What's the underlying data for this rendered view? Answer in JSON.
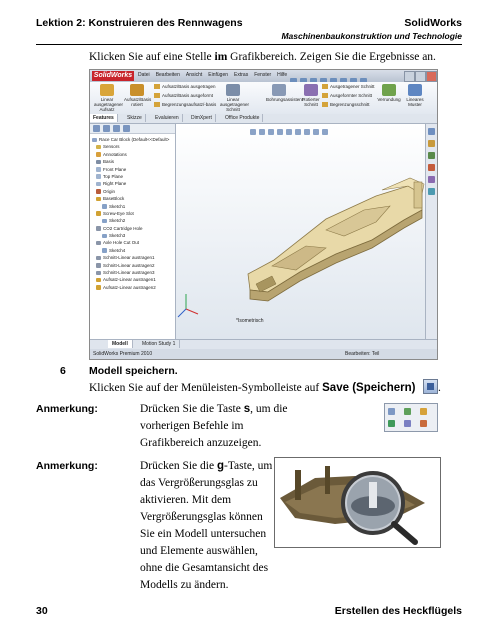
{
  "header": {
    "lesson": "Lektion 2: Konstruieren des Rennwagens",
    "product": "SolidWorks",
    "subtitle": "Maschinenbaukonstruktion und Technologie"
  },
  "intro": {
    "before": "Klicken Sie auf eine Stelle ",
    "bold": "im",
    "after": " Grafikbereich. Zeigen Sie die Ergebnisse an."
  },
  "screenshot": {
    "logo": "SolidWorks",
    "menu": [
      "Datei",
      "Bearbeiten",
      "Ansicht",
      "Einfügen",
      "Extras",
      "Fenster",
      "Hilfe"
    ],
    "ribbon": {
      "big_buttons": [
        {
          "label": "Linear ausgetragener Aufsatz",
          "color": "#d9a53a"
        },
        {
          "label": "Aufsatz/Basis rotiert",
          "color": "#c98f2a"
        },
        {
          "label": "Linear ausgetragener Schnitt",
          "color": "#7b8da8"
        },
        {
          "label": "Bohrungsassistent",
          "color": "#8899b5"
        },
        {
          "label": "Rotierter Schnitt",
          "color": "#8a6fb1"
        },
        {
          "label": "Verrundung",
          "color": "#6fa24c"
        },
        {
          "label": "Lineares Muster",
          "color": "#5e86c2"
        }
      ],
      "small_buttons": [
        "Aufsatz/Basis ausgetragen",
        "Aufsatz/Basis ausgeformt",
        "Begrenzungsaufsatz/-basis",
        "Ausgetragener Schnitt",
        "Ausgeformter Schnitt",
        "Begrenzungsschnitt"
      ]
    },
    "command_tabs": [
      "Features",
      "Skizze",
      "Evaluieren",
      "DimXpert",
      "Office Produkte"
    ],
    "tree": [
      {
        "label": "Race Car Block (Default<<Default>",
        "color": "#8ca3c9"
      },
      {
        "label": "Sensors",
        "color": "#d2b24a"
      },
      {
        "label": "Annotations",
        "color": "#d9a03b"
      },
      {
        "label": "Basis",
        "color": "#7e8da3"
      },
      {
        "label": "Front Plane",
        "color": "#9fb3cf"
      },
      {
        "label": "Top Plane",
        "color": "#9fb3cf"
      },
      {
        "label": "Right Plane",
        "color": "#9fb3cf"
      },
      {
        "label": "Origin",
        "color": "#b85c3c"
      },
      {
        "label": "BaseBlock",
        "color": "#d1a233"
      },
      {
        "label": "Sketch1",
        "color": "#86a1c7"
      },
      {
        "label": "Screw-Eye Slot",
        "color": "#d1a233"
      },
      {
        "label": "Sketch2",
        "color": "#86a1c7"
      },
      {
        "label": "CO2 Cartridge Hole",
        "color": "#8a95a8"
      },
      {
        "label": "Sketch3",
        "color": "#86a1c7"
      },
      {
        "label": "Axle Hole Cut Out",
        "color": "#8a95a8"
      },
      {
        "label": "Sketch4",
        "color": "#86a1c7"
      },
      {
        "label": "Schnitt-Linear austragen1",
        "color": "#8a95a8"
      },
      {
        "label": "Schnitt-Linear austragen2",
        "color": "#8a95a8"
      },
      {
        "label": "Schnitt-Linear austragen3",
        "color": "#8a95a8"
      },
      {
        "label": "Aufsatz-Linear austragen1",
        "color": "#d1a233"
      },
      {
        "label": "Aufsatz-Linear austragen2",
        "color": "#d1a233"
      }
    ],
    "view_label": "*Isometrisch",
    "bottom_tabs": [
      "Modell",
      "Motion Study 1"
    ],
    "status_left": "SolidWorks Premium 2010",
    "status_right": "Bearbeiten: Teil"
  },
  "step6": {
    "number": "6",
    "title": "Modell speichern.",
    "text_before": "Klicken Sie auf der Menüleisten-Symbolleiste auf ",
    "text_bold": "Save (Speichern)",
    "text_after": "."
  },
  "note1": {
    "label": "Anmerkung:",
    "line1_before": "Drücken Sie die Taste ",
    "key": "s",
    "line1_after": ", um die",
    "rest": "vorherigen Befehle im Grafikbereich anzuzeigen."
  },
  "note2": {
    "label": "Anmerkung:",
    "before": "Drücken Sie die ",
    "key": "g",
    "after": "-Taste, um das Vergrößerungsglas zu aktivieren. Mit dem Vergrößerungsglas können Sie ein Modell untersuchen und Elemente auswählen, ohne die Gesamtansicht des Modells zu ändern."
  },
  "footer": {
    "page": "30",
    "chapter": "Erstellen des Heckflügels"
  },
  "colors": {
    "car_body": "#e8d9a8",
    "car_shade": "#b8a470",
    "solidworks_red": "#c8242b"
  }
}
